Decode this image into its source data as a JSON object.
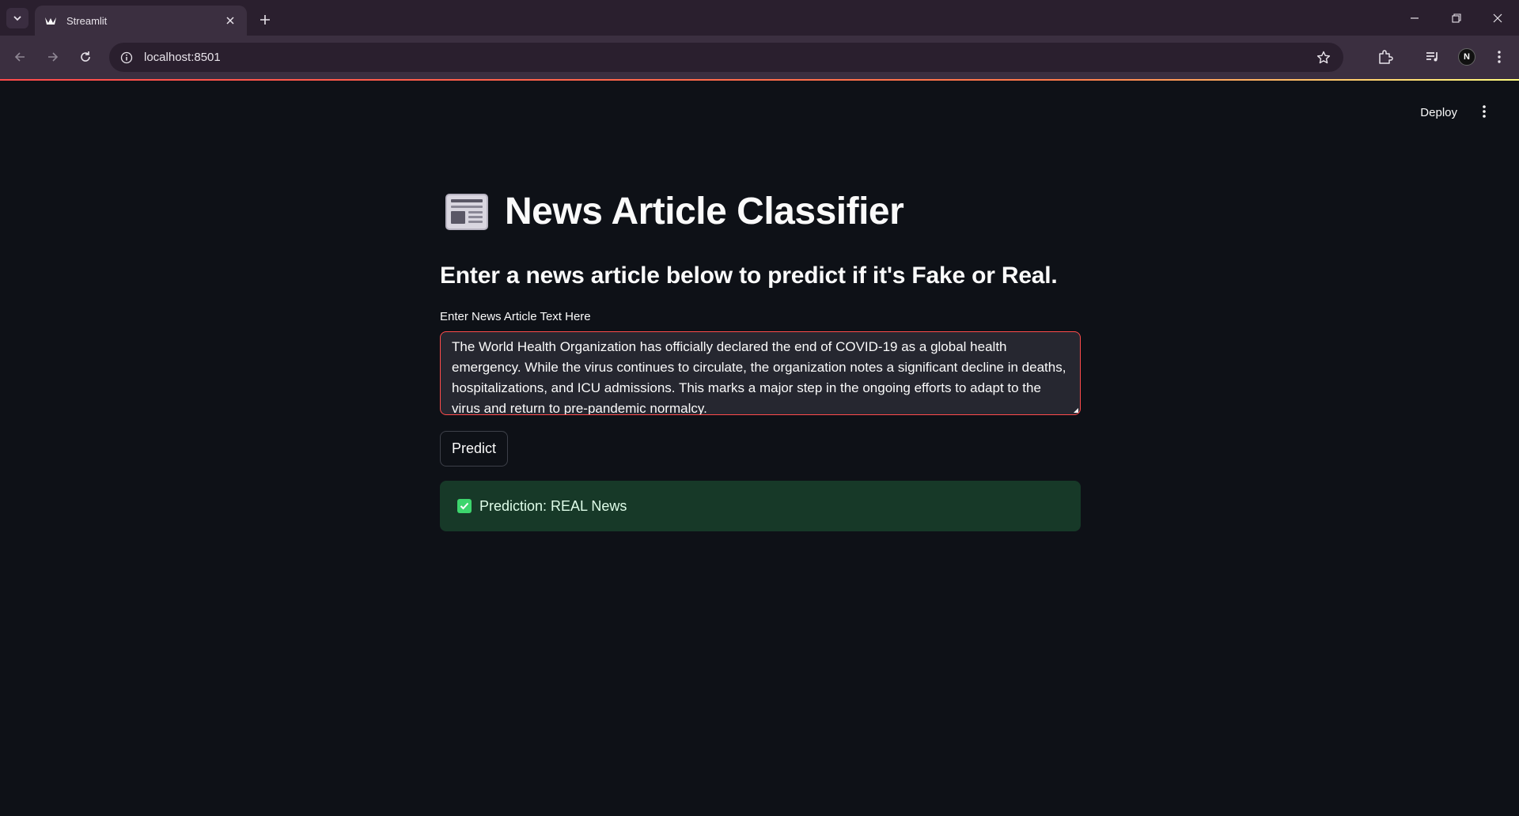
{
  "browser": {
    "tab_title": "Streamlit",
    "url": "localhost:8501",
    "avatar_letter": "N"
  },
  "app": {
    "deploy_label": "Deploy",
    "title": "News Article Classifier",
    "title_icon": "newspaper-icon",
    "subtitle": "Enter a news article below to predict if it's Fake or Real.",
    "input_label": "Enter News Article Text Here",
    "input_value": "The World Health Organization has officially declared the end of COVID-19 as a global health emergency. While the virus continues to circulate, the organization notes a significant decline in deaths, hospitalizations, and ICU admissions. This marks a major step in the ongoing efforts to adapt to the virus and return to pre-pandemic normalcy.",
    "predict_label": "Predict",
    "result_text": "Prediction: REAL News"
  },
  "colors": {
    "background": "#0e1117",
    "accent": "#ff4b4b",
    "success_bg": "#173928",
    "success_icon": "#3dd56d"
  }
}
